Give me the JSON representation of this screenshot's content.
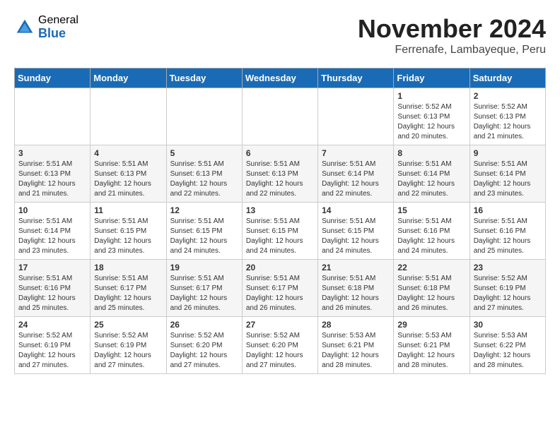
{
  "logo": {
    "general": "General",
    "blue": "Blue"
  },
  "title": "November 2024",
  "location": "Ferrenafe, Lambayeque, Peru",
  "days_of_week": [
    "Sunday",
    "Monday",
    "Tuesday",
    "Wednesday",
    "Thursday",
    "Friday",
    "Saturday"
  ],
  "weeks": [
    [
      {
        "day": "",
        "info": ""
      },
      {
        "day": "",
        "info": ""
      },
      {
        "day": "",
        "info": ""
      },
      {
        "day": "",
        "info": ""
      },
      {
        "day": "",
        "info": ""
      },
      {
        "day": "1",
        "info": "Sunrise: 5:52 AM\nSunset: 6:13 PM\nDaylight: 12 hours and 20 minutes."
      },
      {
        "day": "2",
        "info": "Sunrise: 5:52 AM\nSunset: 6:13 PM\nDaylight: 12 hours and 21 minutes."
      }
    ],
    [
      {
        "day": "3",
        "info": "Sunrise: 5:51 AM\nSunset: 6:13 PM\nDaylight: 12 hours and 21 minutes."
      },
      {
        "day": "4",
        "info": "Sunrise: 5:51 AM\nSunset: 6:13 PM\nDaylight: 12 hours and 21 minutes."
      },
      {
        "day": "5",
        "info": "Sunrise: 5:51 AM\nSunset: 6:13 PM\nDaylight: 12 hours and 22 minutes."
      },
      {
        "day": "6",
        "info": "Sunrise: 5:51 AM\nSunset: 6:13 PM\nDaylight: 12 hours and 22 minutes."
      },
      {
        "day": "7",
        "info": "Sunrise: 5:51 AM\nSunset: 6:14 PM\nDaylight: 12 hours and 22 minutes."
      },
      {
        "day": "8",
        "info": "Sunrise: 5:51 AM\nSunset: 6:14 PM\nDaylight: 12 hours and 22 minutes."
      },
      {
        "day": "9",
        "info": "Sunrise: 5:51 AM\nSunset: 6:14 PM\nDaylight: 12 hours and 23 minutes."
      }
    ],
    [
      {
        "day": "10",
        "info": "Sunrise: 5:51 AM\nSunset: 6:14 PM\nDaylight: 12 hours and 23 minutes."
      },
      {
        "day": "11",
        "info": "Sunrise: 5:51 AM\nSunset: 6:15 PM\nDaylight: 12 hours and 23 minutes."
      },
      {
        "day": "12",
        "info": "Sunrise: 5:51 AM\nSunset: 6:15 PM\nDaylight: 12 hours and 24 minutes."
      },
      {
        "day": "13",
        "info": "Sunrise: 5:51 AM\nSunset: 6:15 PM\nDaylight: 12 hours and 24 minutes."
      },
      {
        "day": "14",
        "info": "Sunrise: 5:51 AM\nSunset: 6:15 PM\nDaylight: 12 hours and 24 minutes."
      },
      {
        "day": "15",
        "info": "Sunrise: 5:51 AM\nSunset: 6:16 PM\nDaylight: 12 hours and 24 minutes."
      },
      {
        "day": "16",
        "info": "Sunrise: 5:51 AM\nSunset: 6:16 PM\nDaylight: 12 hours and 25 minutes."
      }
    ],
    [
      {
        "day": "17",
        "info": "Sunrise: 5:51 AM\nSunset: 6:16 PM\nDaylight: 12 hours and 25 minutes."
      },
      {
        "day": "18",
        "info": "Sunrise: 5:51 AM\nSunset: 6:17 PM\nDaylight: 12 hours and 25 minutes."
      },
      {
        "day": "19",
        "info": "Sunrise: 5:51 AM\nSunset: 6:17 PM\nDaylight: 12 hours and 26 minutes."
      },
      {
        "day": "20",
        "info": "Sunrise: 5:51 AM\nSunset: 6:17 PM\nDaylight: 12 hours and 26 minutes."
      },
      {
        "day": "21",
        "info": "Sunrise: 5:51 AM\nSunset: 6:18 PM\nDaylight: 12 hours and 26 minutes."
      },
      {
        "day": "22",
        "info": "Sunrise: 5:51 AM\nSunset: 6:18 PM\nDaylight: 12 hours and 26 minutes."
      },
      {
        "day": "23",
        "info": "Sunrise: 5:52 AM\nSunset: 6:19 PM\nDaylight: 12 hours and 27 minutes."
      }
    ],
    [
      {
        "day": "24",
        "info": "Sunrise: 5:52 AM\nSunset: 6:19 PM\nDaylight: 12 hours and 27 minutes."
      },
      {
        "day": "25",
        "info": "Sunrise: 5:52 AM\nSunset: 6:19 PM\nDaylight: 12 hours and 27 minutes."
      },
      {
        "day": "26",
        "info": "Sunrise: 5:52 AM\nSunset: 6:20 PM\nDaylight: 12 hours and 27 minutes."
      },
      {
        "day": "27",
        "info": "Sunrise: 5:52 AM\nSunset: 6:20 PM\nDaylight: 12 hours and 27 minutes."
      },
      {
        "day": "28",
        "info": "Sunrise: 5:53 AM\nSunset: 6:21 PM\nDaylight: 12 hours and 28 minutes."
      },
      {
        "day": "29",
        "info": "Sunrise: 5:53 AM\nSunset: 6:21 PM\nDaylight: 12 hours and 28 minutes."
      },
      {
        "day": "30",
        "info": "Sunrise: 5:53 AM\nSunset: 6:22 PM\nDaylight: 12 hours and 28 minutes."
      }
    ]
  ]
}
